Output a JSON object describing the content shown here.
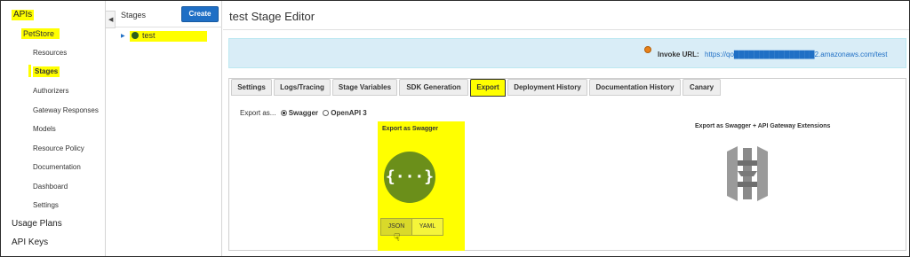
{
  "nav": {
    "apis": "APIs",
    "petstore": "PetStore",
    "resources": "Resources",
    "stages": "Stages",
    "authorizers": "Authorizers",
    "gateway_responses": "Gateway Responses",
    "models": "Models",
    "resource_policy": "Resource Policy",
    "documentation": "Documentation",
    "dashboard": "Dashboard",
    "settings": "Settings",
    "usage_plans": "Usage Plans",
    "api_keys": "API Keys"
  },
  "stages_panel": {
    "title": "Stages",
    "create_label": "Create",
    "tree_item": "test"
  },
  "editor": {
    "title": "test Stage Editor",
    "invoke_label": "Invoke URL:",
    "invoke_url": "https://qo████████████████2.amazonaws.com/test"
  },
  "tabs": [
    "Settings",
    "Logs/Tracing",
    "Stage Variables",
    "SDK Generation",
    "Export",
    "Deployment History",
    "Documentation History",
    "Canary"
  ],
  "active_tab": "Export",
  "export": {
    "export_as_label": "Export as...",
    "option_swagger": "Swagger",
    "option_openapi": "OpenAPI 3",
    "swagger_card_title": "Export as Swagger",
    "json_label": "JSON",
    "yaml_label": "YAML",
    "extensions_title": "Export as Swagger + API Gateway Extensions"
  },
  "colors": {
    "highlight": "#ffff00",
    "swagger_green": "#6b8f1a",
    "link_blue": "#1f6fc5",
    "invoke_bg": "#d9edf7",
    "aws_gray": "#8a8a8a"
  }
}
